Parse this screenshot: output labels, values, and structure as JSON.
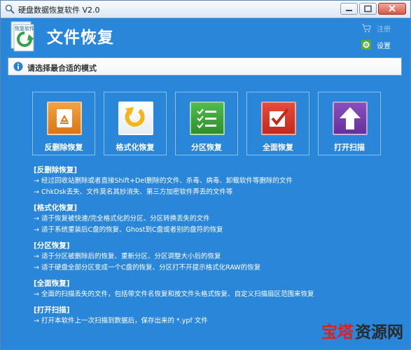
{
  "window": {
    "title": "硬盘数据恢复软件 V2.0"
  },
  "header": {
    "app_name": "文件恢复",
    "logo_text": "恢复软件",
    "register_label": "注册",
    "settings_label": "设置"
  },
  "mode_bar": {
    "text": "请选择最合适的模式"
  },
  "modes": [
    {
      "label": "反删除恢复",
      "icon": "recycle-icon",
      "color": "#e8892a"
    },
    {
      "label": "格式化恢复",
      "icon": "refresh-arrow-icon",
      "color": "#3b8fd6"
    },
    {
      "label": "分区恢复",
      "icon": "checklist-icon",
      "color": "#3da43a"
    },
    {
      "label": "全面恢复",
      "icon": "checkmark-icon",
      "color": "#d63528"
    },
    {
      "label": "打开扫描",
      "icon": "upload-arrow-icon",
      "color": "#7a3fa8"
    }
  ],
  "descriptions": [
    {
      "heading": "[反删除恢复]",
      "lines": [
        "→ 经过回收站删除或者直接Shift+Del删除的文件、杀毒、病毒、卸载软件等删除的文件",
        "→ ChkDsk丢失、文件莫名其妙消失、第三方加密软件弄丢的文件等"
      ]
    },
    {
      "heading": "[格式化恢复]",
      "lines": [
        "→ 适于恢复被快速/完全格式化的分区、分区转换丢失的文件",
        "→ 适于系统重装后C盘的恢复、Ghost到C盘或者别的盘符的恢复"
      ]
    },
    {
      "heading": "[分区恢复]",
      "lines": [
        "→ 适于分区被删除后的恢复、重新分区、分区调整大小后的恢复",
        "→ 适于硬盘全部分区变成一个C盘的恢复、分区打不开提示格式化RAW的恢复"
      ]
    },
    {
      "heading": "[全面恢复]",
      "lines": [
        "→ 全面的扫描丢失的文件，包括带文件名恢复和按文件头格式恢复、自定义扫描扇区范围来恢复"
      ]
    },
    {
      "heading": "[打开扫描]",
      "lines": [
        "→ 打开本软件上一次扫描到数据后，保存出来的 *.ypf 文件"
      ]
    }
  ],
  "watermark": {
    "part1": "宝塔",
    "part2": "资源网"
  }
}
